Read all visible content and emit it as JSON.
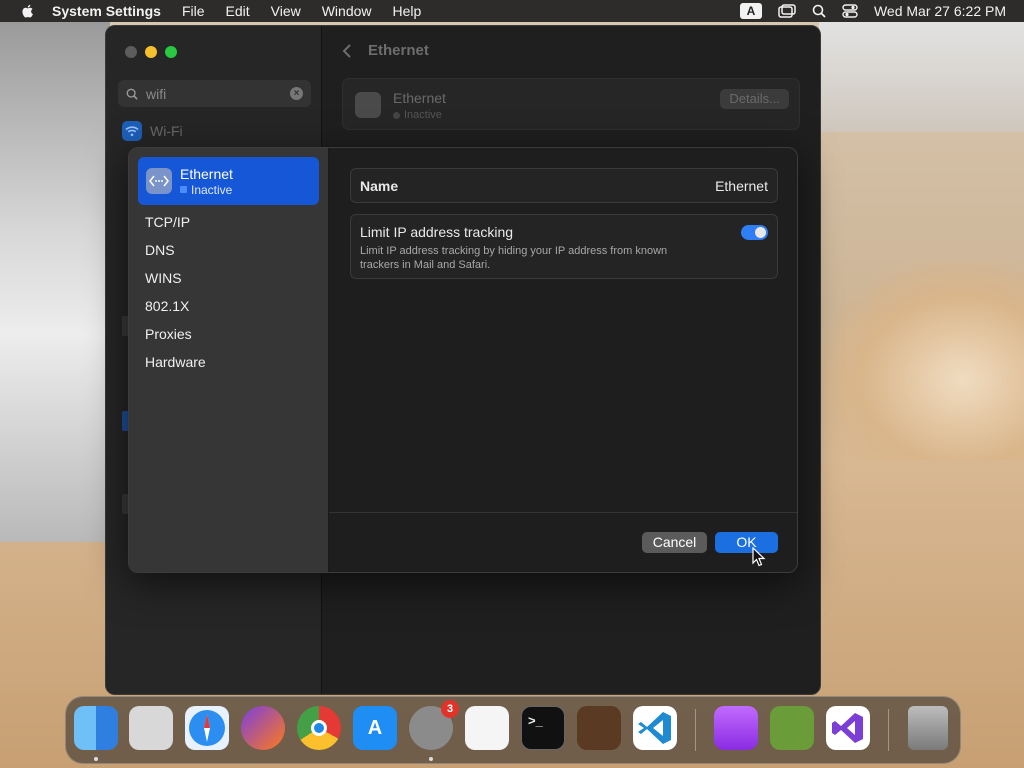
{
  "menubar": {
    "app_name": "System Settings",
    "menus": [
      "File",
      "Edit",
      "View",
      "Window",
      "Help"
    ],
    "input_source": "A",
    "datetime": "Wed Mar 27  6:22 PM"
  },
  "settings_window": {
    "search": {
      "value": "wifi"
    },
    "sidebar_result": "Wi-Fi",
    "header_title": "Ethernet",
    "service_card": {
      "name": "Ethernet",
      "status": "Inactive",
      "details_button": "Details..."
    }
  },
  "sheet": {
    "service": {
      "name": "Ethernet",
      "status": "Inactive"
    },
    "nav": [
      "TCP/IP",
      "DNS",
      "WINS",
      "802.1X",
      "Proxies",
      "Hardware"
    ],
    "name_row": {
      "label": "Name",
      "value": "Ethernet"
    },
    "tracking": {
      "title": "Limit IP address tracking",
      "description": "Limit IP address tracking by hiding your IP address from known trackers in Mail and Safari.",
      "enabled": true
    },
    "cancel_label": "Cancel",
    "ok_label": "OK"
  },
  "dock": {
    "settings_badge": "3",
    "apps": [
      "finder-icon",
      "launchpad-icon",
      "safari-icon",
      "firefox-icon",
      "chrome-icon",
      "app-store-icon",
      "system-settings-icon",
      "textedit-icon",
      "terminal-icon",
      "garageband-icon",
      "vscode-icon",
      "podcasts-icon",
      "minecraft-icon",
      "visual-studio-icon",
      "trash-icon"
    ]
  },
  "colors": {
    "accent": "#1557d6",
    "ok_button": "#1b6fe0",
    "toggle_on": "#2f7ef6"
  }
}
